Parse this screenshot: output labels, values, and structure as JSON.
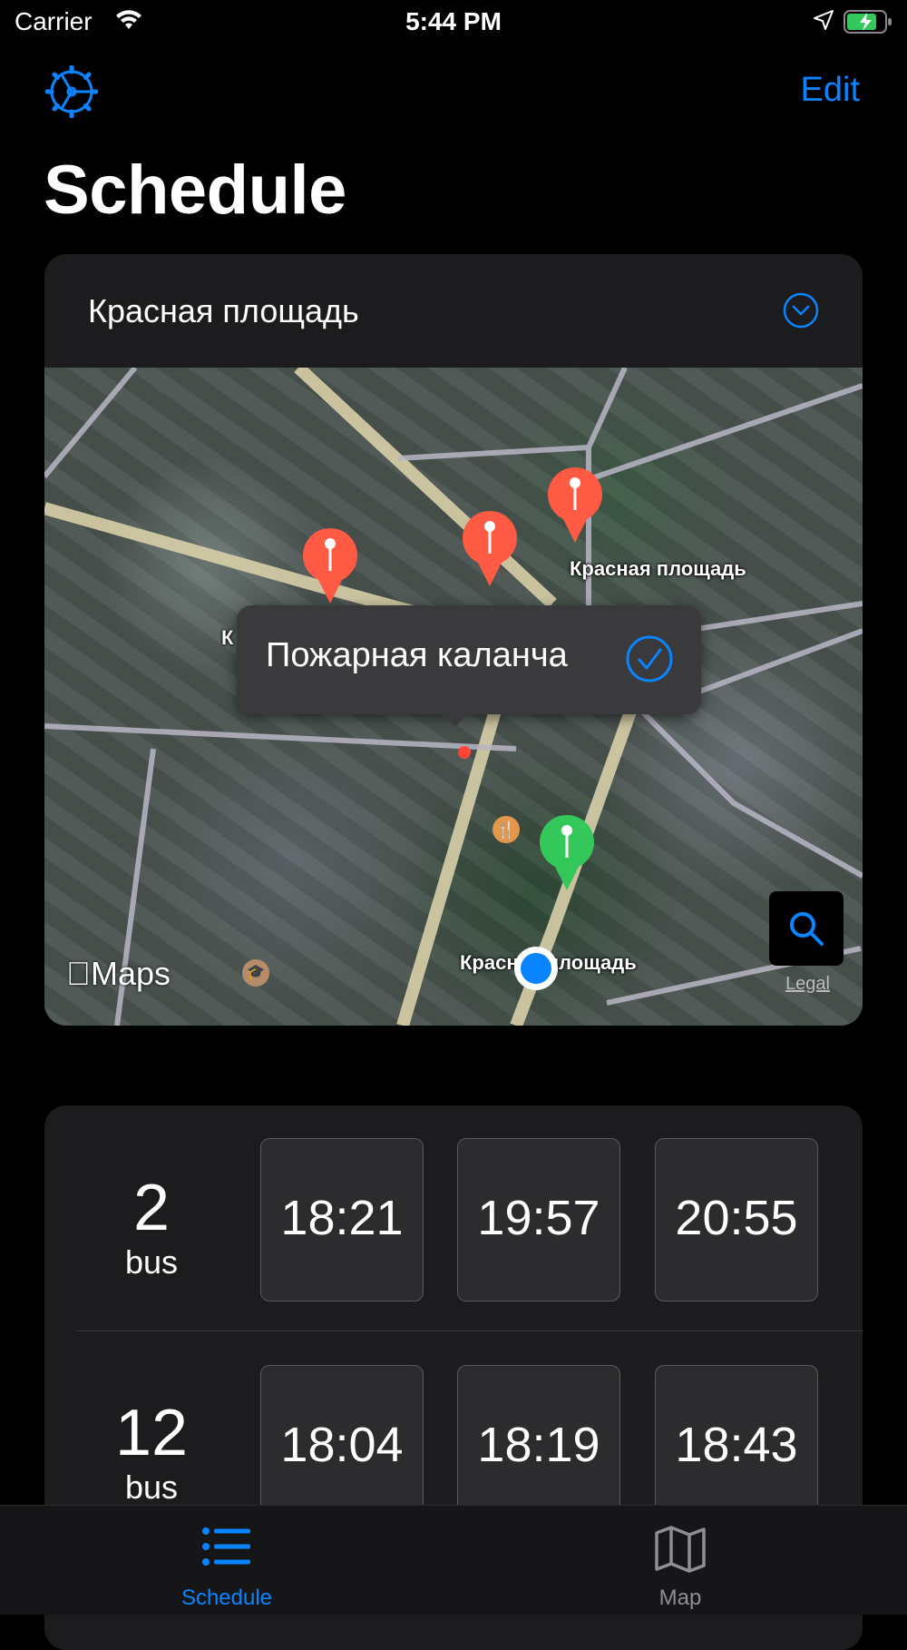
{
  "status": {
    "carrier": "Carrier",
    "time": "5:44 PM"
  },
  "nav": {
    "edit_label": "Edit",
    "title": "Schedule"
  },
  "stop_card": {
    "stop_name": "Красная площадь",
    "callout": "Пожарная каланча",
    "labels": [
      "Красная площадь",
      "Красная площадь",
      "К"
    ],
    "maps_logo": "Maps",
    "legal": "Legal"
  },
  "routes": [
    {
      "number": "2",
      "unit": "bus",
      "times": [
        "18:21",
        "19:57",
        "20:55"
      ]
    },
    {
      "number": "12",
      "unit": "bus",
      "times": [
        "18:04",
        "18:19",
        "18:43"
      ]
    }
  ],
  "tabs": [
    {
      "label": "Schedule",
      "active": true
    },
    {
      "label": "Map",
      "active": false
    }
  ],
  "colors": {
    "accent": "#0a84ff",
    "pin_red": "#ff5a43",
    "pin_green": "#34c759"
  }
}
